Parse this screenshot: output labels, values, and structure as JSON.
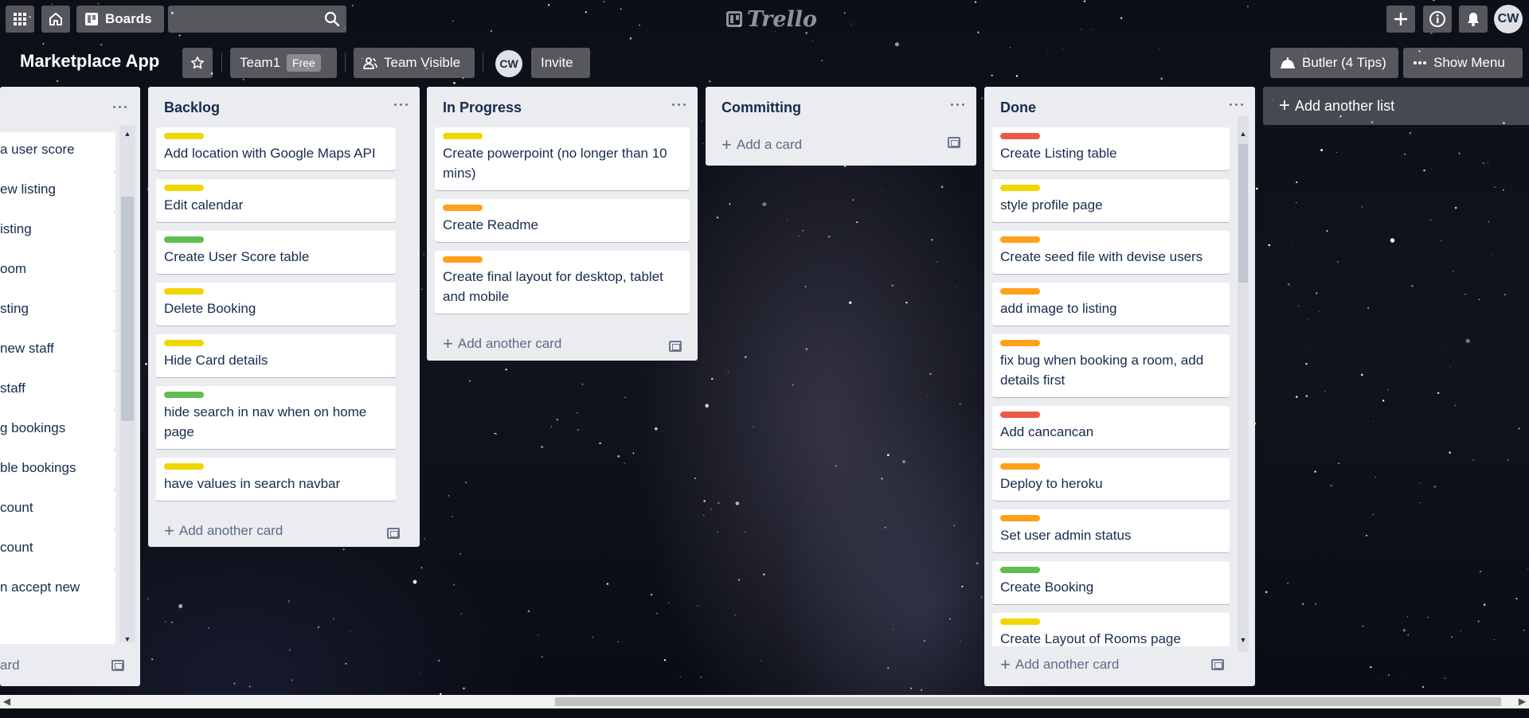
{
  "app": {
    "logo_text": "Trello"
  },
  "topbar": {
    "boards_label": "Boards",
    "search_value": "",
    "user_initials": "CW"
  },
  "board": {
    "title": "Marketplace App",
    "team_label": "Team1",
    "team_plan_badge": "Free",
    "visibility_label": "Team Visible",
    "member_initials": "CW",
    "invite_label": "Invite",
    "butler_label": "Butler (4 Tips)",
    "show_menu_label": "Show Menu"
  },
  "label_colors": {
    "yellow": "#f2d600",
    "green": "#61bd4f",
    "orange": "#ff9f1a",
    "red": "#eb5a46"
  },
  "lists": [
    {
      "title": "",
      "cards": [
        {
          "title": "a user score"
        },
        {
          "title": "ew listing"
        },
        {
          "title": "isting"
        },
        {
          "title": "oom"
        },
        {
          "title": "sting"
        },
        {
          "title": "new staff"
        },
        {
          "title": "staff"
        },
        {
          "title": "g bookings"
        },
        {
          "title": "ble bookings"
        },
        {
          "title": "count"
        },
        {
          "title": "count"
        },
        {
          "title": "n accept new"
        },
        {
          "title": ""
        }
      ],
      "add_card_label": "ard"
    },
    {
      "title": "Backlog",
      "cards": [
        {
          "label": "yellow",
          "title": "Add location with Google Maps API"
        },
        {
          "label": "yellow",
          "title": "Edit calendar"
        },
        {
          "label": "green",
          "title": "Create User Score table"
        },
        {
          "label": "yellow",
          "title": "Delete Booking"
        },
        {
          "label": "yellow",
          "title": "Hide Card details"
        },
        {
          "label": "green",
          "title": "hide search in nav when on home page"
        },
        {
          "label": "yellow",
          "title": "have values in search navbar"
        }
      ],
      "add_card_label": "Add another card"
    },
    {
      "title": "In Progress",
      "cards": [
        {
          "label": "yellow",
          "title": "Create powerpoint (no longer than 10 mins)"
        },
        {
          "label": "orange",
          "title": "Create Readme"
        },
        {
          "label": "orange",
          "title": "Create final layout for desktop, tablet and mobile"
        }
      ],
      "add_card_label": "Add another card"
    },
    {
      "title": "Committing",
      "cards": [],
      "add_card_label": "Add a card"
    },
    {
      "title": "Done",
      "cards": [
        {
          "label": "red",
          "title": "Create Listing table"
        },
        {
          "label": "yellow",
          "title": "style profile page"
        },
        {
          "label": "orange",
          "title": "Create seed file with devise users"
        },
        {
          "label": "orange",
          "title": "add image to listing"
        },
        {
          "label": "orange",
          "title": "fix bug when booking a room, add details first"
        },
        {
          "label": "red",
          "title": "Add cancancan"
        },
        {
          "label": "orange",
          "title": "Deploy to heroku"
        },
        {
          "label": "orange",
          "title": "Set user admin status"
        },
        {
          "label": "green",
          "title": "Create Booking"
        },
        {
          "label": "yellow",
          "title": "Create Layout of Rooms page"
        }
      ],
      "add_card_label": "Add another card"
    }
  ],
  "add_list_label": "Add another list"
}
